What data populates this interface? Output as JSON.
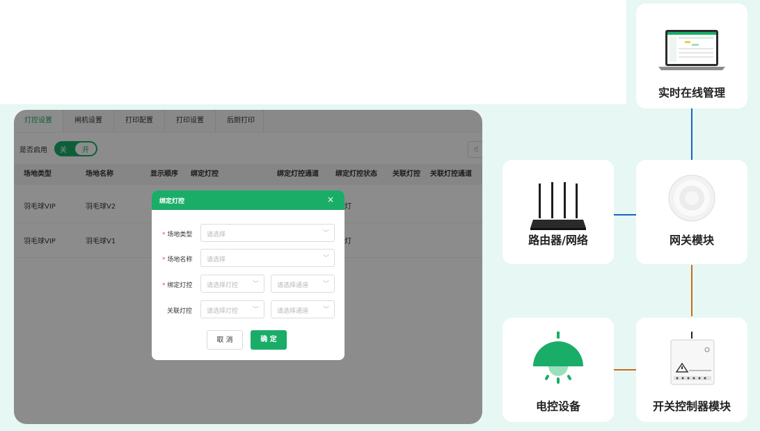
{
  "tabs": [
    "灯控设置",
    "闸机设置",
    "打印配置",
    "打印设置",
    "后厨打印"
  ],
  "toggle": {
    "label": "是否启用",
    "off": "关",
    "on": "开"
  },
  "table": {
    "headers": [
      "场地类型",
      "场地名称",
      "显示顺序",
      "绑定灯控",
      "绑定灯控通道",
      "绑定灯控状态",
      "关联灯控",
      "关联灯控通道"
    ],
    "rows": [
      {
        "type": "羽毛球VIP",
        "name": "羽毛球V2",
        "status_fragment": "灯"
      },
      {
        "type": "羽毛球VIP",
        "name": "羽毛球V1",
        "status_fragment": "灯"
      }
    ]
  },
  "modal": {
    "title": "绑定灯控",
    "close": "×",
    "fields": [
      {
        "label": "场地类型",
        "required": true,
        "placeholder": "请选择"
      },
      {
        "label": "场地名称",
        "required": true,
        "placeholder": "请选择"
      },
      {
        "label": "绑定灯控",
        "required": true,
        "placeholder": "请选择灯控",
        "placeholder2": "请选择通道"
      },
      {
        "label": "关联灯控",
        "required": false,
        "placeholder": "请选择灯控",
        "placeholder2": "请选择通道"
      }
    ],
    "cancel": "取 消",
    "ok": "确 定"
  },
  "cards": {
    "management": "实时在线管理",
    "router": "路由器/网络",
    "gateway": "网关模块",
    "device": "电控设备",
    "switch": "开关控制器模块"
  },
  "colors": {
    "accent": "#1aad68",
    "line_blue": "#1f5fc6",
    "line_orange": "#c86b1a",
    "background": "#e6f7f4"
  }
}
